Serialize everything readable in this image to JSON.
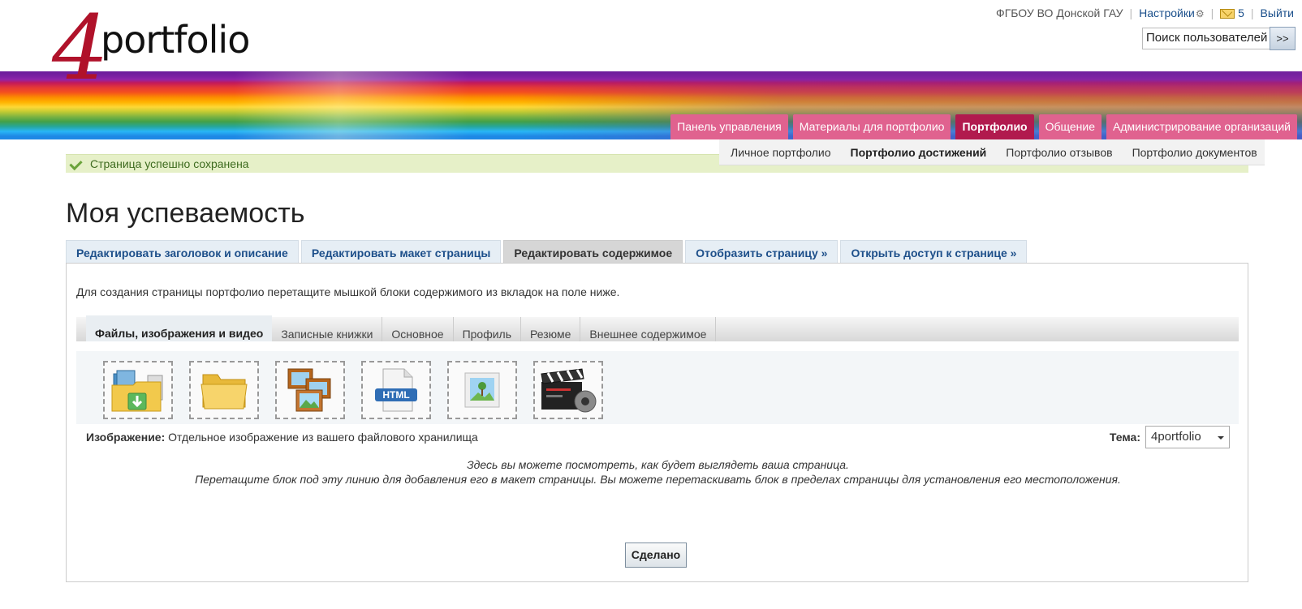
{
  "header": {
    "logo_prefix": "4",
    "logo_text": "portfolio",
    "org_name": "ФГБОУ ВО Донской ГАУ",
    "settings_label": "Настройки",
    "messages_count": "5",
    "logout_label": "Выйти",
    "separator": "|",
    "search_value": "Поиск пользователей",
    "search_button": ">>"
  },
  "main_nav": [
    {
      "label": "Панель управления"
    },
    {
      "label": "Материалы для портфолио"
    },
    {
      "label": "Портфолио",
      "active": true
    },
    {
      "label": "Общение"
    },
    {
      "label": "Администрирование организаций"
    }
  ],
  "sub_nav": [
    {
      "label": "Личное портфолио"
    },
    {
      "label": "Портфолио достижений",
      "active": true
    },
    {
      "label": "Портфолио отзывов"
    },
    {
      "label": "Портфолио документов"
    }
  ],
  "success_message": "Страница успешно сохранена",
  "page_title": "Моя успеваемость",
  "edit_tabs": [
    {
      "label": "Редактировать заголовок и описание"
    },
    {
      "label": "Редактировать макет страницы"
    },
    {
      "label": "Редактировать содержимое",
      "active": true
    },
    {
      "label": "Отобразить страницу »"
    },
    {
      "label": "Открыть доступ к странице »"
    }
  ],
  "instructions": "Для создания страницы портфолио перетащите мышкой блоки содержимого из вкладок на поле ниже.",
  "block_tabs": [
    {
      "label": "Файлы, изображения и видео",
      "active": true
    },
    {
      "label": "Записные книжки"
    },
    {
      "label": "Основное"
    },
    {
      "label": "Профиль"
    },
    {
      "label": "Резюме"
    },
    {
      "label": "Внешнее содержимое"
    }
  ],
  "blocks": [
    {
      "icon": "file-download-icon"
    },
    {
      "icon": "folder-icon"
    },
    {
      "icon": "image-gallery-icon"
    },
    {
      "icon": "html-file-icon"
    },
    {
      "icon": "image-icon"
    },
    {
      "icon": "video-clapperboard-icon"
    }
  ],
  "block_description": {
    "label": "Изображение:",
    "text": "Отдельное изображение из вашего файлового хранилища"
  },
  "theme": {
    "label": "Тема:",
    "value": "4portfolio"
  },
  "hint_line1": "Здесь вы можете посмотреть, как будет выглядеть ваша страница.",
  "hint_line2": "Перетащите блок под эту линию для добавления его в макет страницы. Вы можете перетаскивать блок в пределах страницы для установления его местоположения.",
  "done_button": "Сделано",
  "colors": {
    "nav_pink": "#e0628f",
    "nav_active": "#b11a4e",
    "link_blue": "#1d4f8a",
    "success_bg": "#e6f0c8"
  }
}
